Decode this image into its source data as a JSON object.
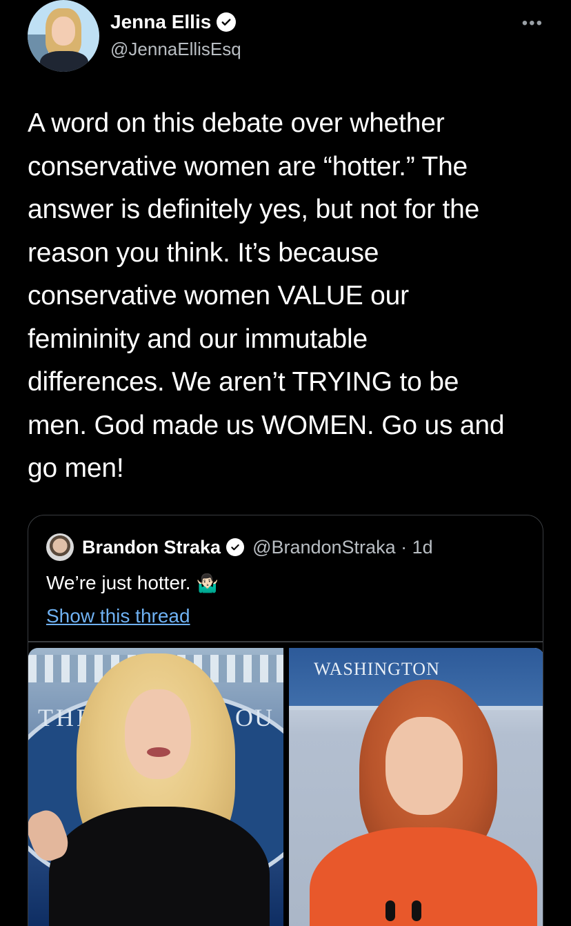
{
  "tweet": {
    "author": {
      "display_name": "Jenna Ellis",
      "handle": "@JennaEllisEsq",
      "verified": true
    },
    "more_icon": "more-dots-icon",
    "text_lines": [
      "A word on this debate over whether",
      "conservative women are “hotter.” The",
      "answer is definitely yes, but not for the",
      "reason you think. It’s because",
      "conservative women VALUE our",
      "femininity and our immutable",
      "differences. We aren’t TRYING to be",
      "men. God made us WOMEN. Go us and",
      "go men!"
    ]
  },
  "quoted_tweet": {
    "author": {
      "display_name": "Brandon Straka",
      "handle_time": "@BrandonStraka · 1d",
      "verified": true
    },
    "text": "We’re just hotter.",
    "emoji": "🤷🏻‍♂️",
    "show_thread": "Show this thread",
    "images": [
      {
        "sign_text_left": "THE V",
        "sign_text_right": "OU"
      },
      {
        "sign_text": "WASHINGTON"
      }
    ]
  },
  "colors": {
    "background": "#000000",
    "text": "#ffffff",
    "secondary_text": "#b9bec3",
    "link": "#6fb1f2",
    "border": "#3a3d41"
  }
}
